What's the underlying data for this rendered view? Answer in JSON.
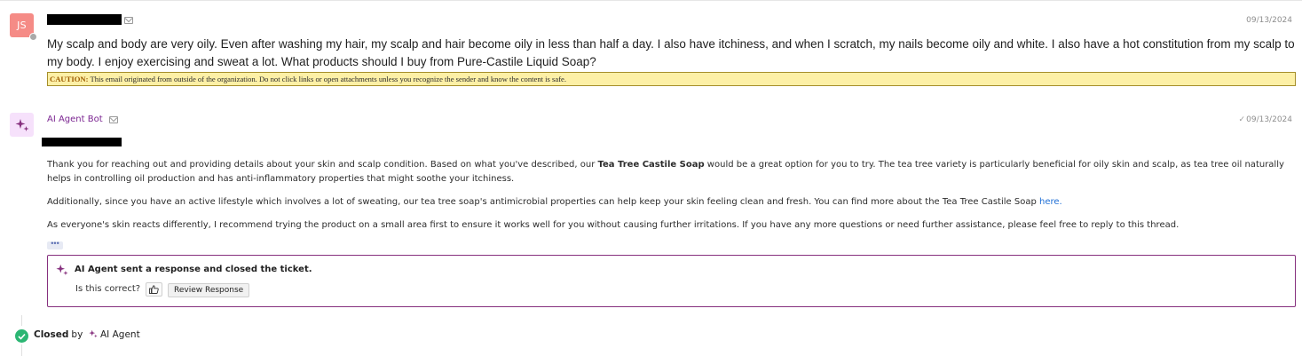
{
  "message_customer": {
    "avatar_initials": "JS",
    "date": "09/13/2024",
    "body": "My scalp and body are very oily. Even after washing my hair, my scalp and hair become oily in less than half a day. I also have itchiness, and when I scratch, my nails become oily and white. I also have a hot constitution from my scalp to my body. I enjoy exercising and sweat a lot. What products should I buy from Pure-Castile Liquid Soap?",
    "caution_label": "CAUTION:",
    "caution_text": " This email originated from outside of the organization. Do not click links or open attachments unless you recognize the sender and know the content is safe."
  },
  "message_bot": {
    "sender": "AI Agent Bot",
    "date": "09/13/2024",
    "p1_before": "Thank you for reaching out and providing details about your skin and scalp condition. Based on what you've described, our ",
    "p1_bold": "Tea Tree Castile Soap",
    "p1_after": " would be a great option for you to try. The tea tree variety is particularly beneficial for oily skin and scalp, as tea tree oil naturally helps in controlling oil production and has anti-inflammatory properties that might soothe your itchiness.",
    "p2_before": "Additionally, since you have an active lifestyle which involves a lot of sweating, our tea tree soap's antimicrobial properties can help keep your skin feeling clean and fresh. You can find more about the Tea Tree Castile Soap ",
    "p2_link": "here.",
    "p3": "As everyone's skin reacts differently, I recommend trying the product on a small area first to ensure it works well for you without causing further irritations. If you have any more questions or need further assistance, please feel free to reply to this thread.",
    "ellipsis": "•••"
  },
  "response_card": {
    "title": "AI Agent sent a response and closed the ticket.",
    "question": "Is this correct?",
    "review_button": "Review Response"
  },
  "closed_event": {
    "status": "Closed",
    "by": "by",
    "agent": "AI Agent"
  },
  "colors": {
    "accent_purple": "#86307e",
    "closed_green": "#2bb673",
    "caution_bg": "#fdf0a6",
    "link_blue": "#1f6fd6"
  }
}
